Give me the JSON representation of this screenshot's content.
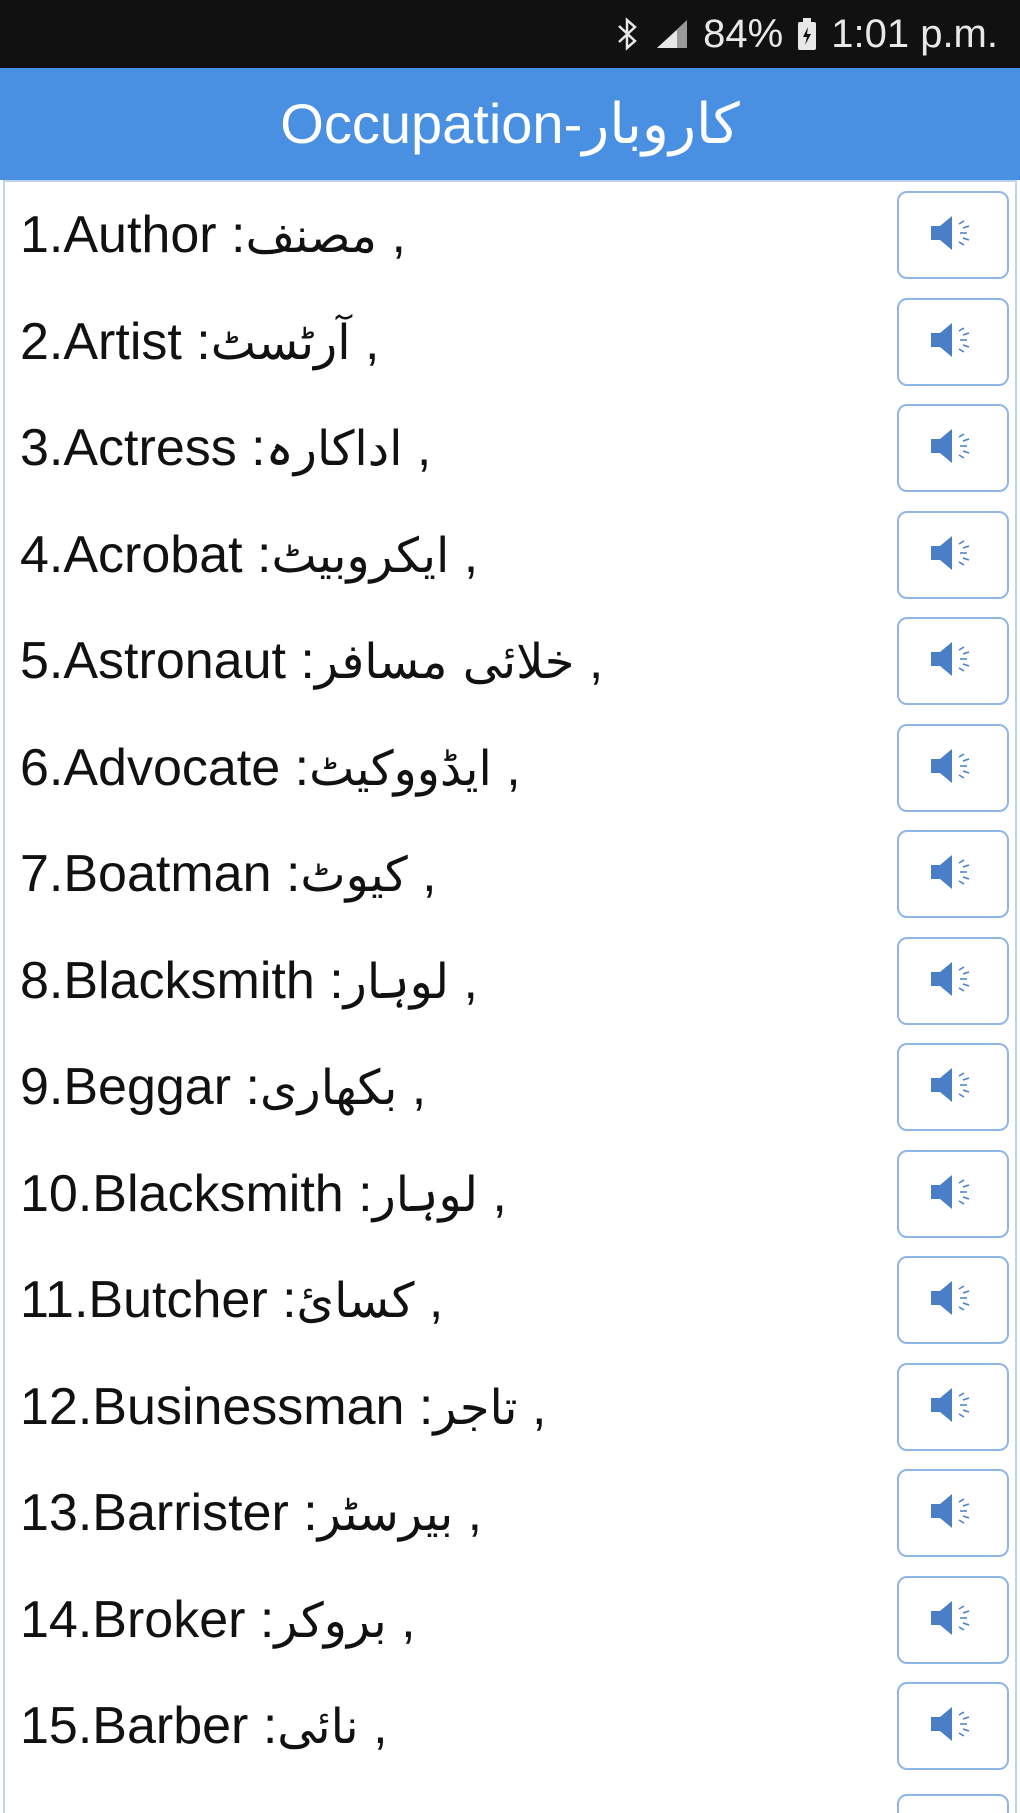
{
  "status_bar": {
    "battery": "84%",
    "time": "1:01 p.m.",
    "icons": [
      "bluetooth-icon",
      "signal-icon",
      "battery-icon"
    ]
  },
  "header": {
    "title": "Occupation-کاروبار"
  },
  "colors": {
    "header": "#4a90e2",
    "status_bar": "#111111",
    "button_border": "#8fb6e6",
    "speaker_icon": "#4a7fc7"
  },
  "items": [
    {
      "english": "1.Author",
      "urdu": "مصنف",
      "button_icon": "speaker-icon"
    },
    {
      "english": "2.Artist",
      "urdu": "آرٹسٹ",
      "button_icon": "speaker-icon"
    },
    {
      "english": "3.Actress",
      "urdu": "اداکارہ",
      "button_icon": "speaker-icon"
    },
    {
      "english": "4.Acrobat",
      "urdu": "ایکروبیٹ",
      "button_icon": "speaker-icon"
    },
    {
      "english": "5.Astronaut",
      "urdu": "خلائی مسافر",
      "button_icon": "speaker-icon"
    },
    {
      "english": "6.Advocate",
      "urdu": "ایڈووکیٹ",
      "button_icon": "speaker-icon"
    },
    {
      "english": "7.Boatman",
      "urdu": "کیوٹ",
      "button_icon": "speaker-icon"
    },
    {
      "english": "8.Blacksmith",
      "urdu": "لوہار",
      "button_icon": "speaker-icon"
    },
    {
      "english": "9.Beggar",
      "urdu": "بکھاری",
      "button_icon": "speaker-icon"
    },
    {
      "english": "10.Blacksmith",
      "urdu": "لوہار",
      "button_icon": "speaker-icon"
    },
    {
      "english": "11.Butcher",
      "urdu": "کسائ",
      "button_icon": "speaker-icon"
    },
    {
      "english": "12.Businessman",
      "urdu": "تاجر",
      "button_icon": "speaker-icon"
    },
    {
      "english": "13.Barrister",
      "urdu": "بیرسٹر",
      "button_icon": "speaker-icon"
    },
    {
      "english": "14.Broker",
      "urdu": "بروکر",
      "button_icon": "speaker-icon"
    },
    {
      "english": "15.Barber",
      "urdu": "نائی",
      "button_icon": "speaker-icon"
    }
  ]
}
